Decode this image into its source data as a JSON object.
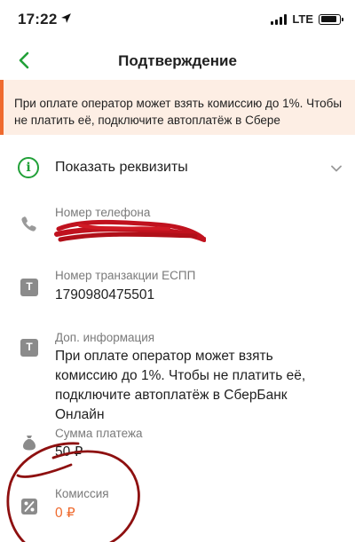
{
  "status_bar": {
    "time": "17:22",
    "network": "LTE"
  },
  "header": {
    "title": "Подтверждение"
  },
  "banner": {
    "text": "При оплате оператор может взять комиссию до 1%. Чтобы не платить её, подключите автоплатёж в Сбере"
  },
  "details_toggle": {
    "label": "Показать реквизиты"
  },
  "fields": {
    "phone": {
      "label": "Номер телефона",
      "value": ""
    },
    "transaction": {
      "label": "Номер транзакции ЕСПП",
      "value": "1790980475501"
    },
    "extra_info": {
      "label": "Доп. информация",
      "value": "При оплате оператор может взять комиссию до 1%. Чтобы не платить её, подключите автоплатёж в СберБанк Онлайн"
    },
    "amount": {
      "label": "Сумма платежа",
      "value": "50 ₽"
    },
    "commission": {
      "label": "Комиссия",
      "value": "0 ₽"
    }
  },
  "colors": {
    "accent": "#21a038",
    "warning": "#ef6a2e",
    "annotation": "#8e1010",
    "icon_gray": "#8b8b8b"
  },
  "icons": [
    "location-arrow-icon",
    "signal-icon",
    "battery-icon",
    "back-chevron-icon",
    "info-icon",
    "chevron-down-icon",
    "phone-icon",
    "text-icon",
    "money-bag-icon",
    "percent-icon"
  ]
}
